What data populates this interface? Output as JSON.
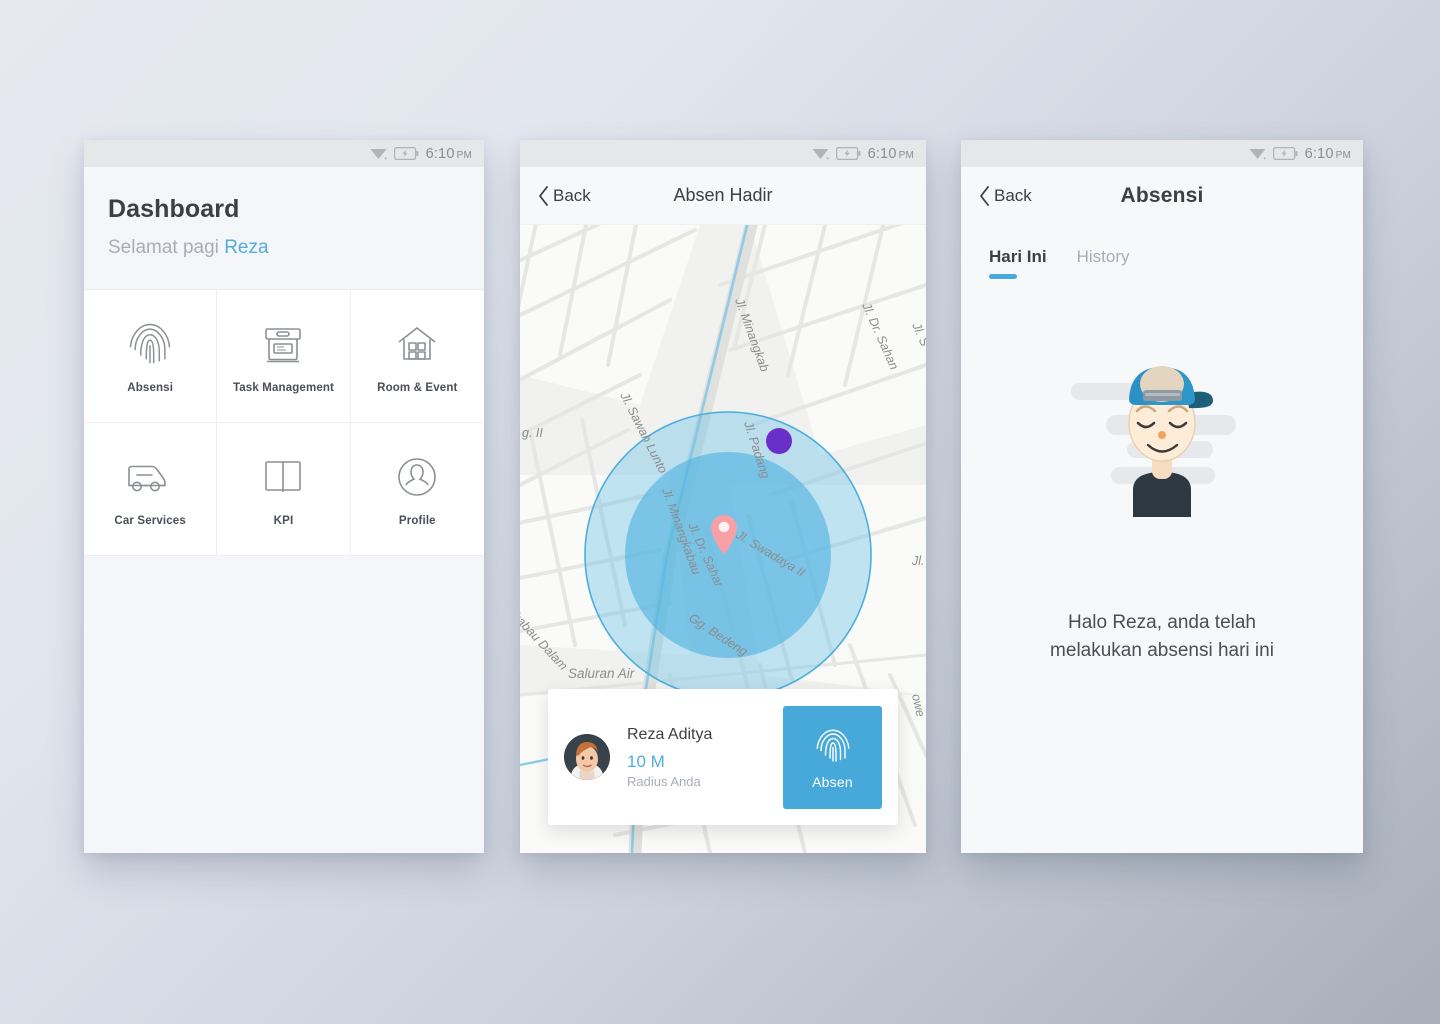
{
  "statusbar": {
    "time": "6:10",
    "ampm": "PM",
    "wifi_icon": "wifi-icon",
    "battery_icon": "battery-charging-icon"
  },
  "colors": {
    "accent": "#46a9da",
    "accent_text": "#4eaede",
    "text_dark": "#3c4043",
    "text_muted": "#a8aeb6",
    "screen_bg": "#f7f8fa",
    "statusbar_bg": "#e6e7e8",
    "marker_purple": "#6b2fc9",
    "marker_pink": "#f9a0a6",
    "geofence_fill": "#5bc0e8",
    "page_bg_start": "#e6e9f0",
    "page_bg_end": "#a7aeba"
  },
  "screen1": {
    "title": "Dashboard",
    "greeting_prefix": "Selamat pagi ",
    "greeting_user": "Reza",
    "menu": [
      {
        "label": "Absensi",
        "icon": "fingerprint-icon"
      },
      {
        "label": "Task Management",
        "icon": "archive-box-icon"
      },
      {
        "label": "Room & Event",
        "icon": "house-icon"
      },
      {
        "label": "Car Services",
        "icon": "van-icon"
      },
      {
        "label": "KPI",
        "icon": "open-book-icon"
      },
      {
        "label": "Profile",
        "icon": "user-circle-icon"
      }
    ]
  },
  "screen2": {
    "back_label": "Back",
    "title": "Absen Hadir",
    "map": {
      "street_labels": [
        "Jl. Sawah Lunto",
        "Jl. Minangkab",
        "Jl. Dr. Sahar",
        "Jl. Minangkabau",
        "Jl. Padang",
        "Jl. Dr. Sahar",
        "Jl. Swadaya II",
        "Gg. Bedeng",
        "Saluran Air",
        "kabau Dalam",
        "g. II",
        "Jl.",
        "owe"
      ],
      "user_marker": "purple-dot-marker",
      "place_marker": "pink-location-pin"
    },
    "card": {
      "name": "Reza Aditya",
      "distance": "10 M",
      "distance_caption": "Radius Anda",
      "avatar": "user-avatar",
      "button_label": "Absen",
      "button_icon": "fingerprint-icon"
    }
  },
  "screen3": {
    "back_label": "Back",
    "title": "Absensi",
    "tabs": [
      {
        "label": "Hari Ini",
        "active": true
      },
      {
        "label": "History",
        "active": false
      }
    ],
    "illustration": "person-with-cap-illustration",
    "message_line1": "Halo Reza, anda telah",
    "message_line2": "melakukan absensi hari ini"
  }
}
